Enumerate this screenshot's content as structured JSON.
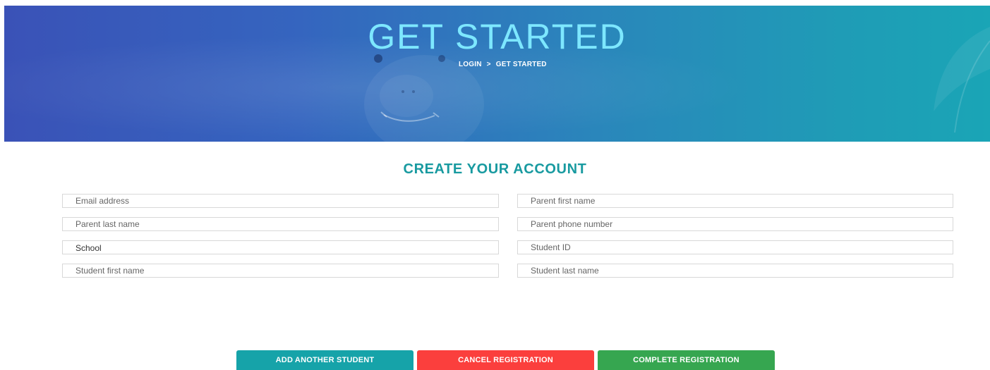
{
  "hero": {
    "title": "GET STARTED",
    "breadcrumb": {
      "items": [
        "LOGIN",
        "GET STARTED"
      ],
      "separator": ">"
    },
    "gradient_colors": [
      "#3a52b7",
      "#1aa5b6"
    ]
  },
  "form": {
    "title": "CREATE YOUR ACCOUNT",
    "fields": {
      "email_placeholder": "Email address",
      "parent_first_name_placeholder": "Parent first name",
      "parent_last_name_placeholder": "Parent last name",
      "parent_phone_placeholder": "Parent phone number",
      "school_label": "School",
      "student_id_placeholder": "Student ID",
      "student_first_name_placeholder": "Student first name",
      "student_last_name_placeholder": "Student last name"
    }
  },
  "actions": {
    "add_student_label": "ADD ANOTHER STUDENT",
    "cancel_label": "CANCEL REGISTRATION",
    "complete_label": "COMPLETE REGISTRATION"
  },
  "colors": {
    "title_accent": "#189aa0",
    "add_button": "#16a3a9",
    "cancel_button": "#fb3f3d",
    "complete_button": "#36a650"
  }
}
